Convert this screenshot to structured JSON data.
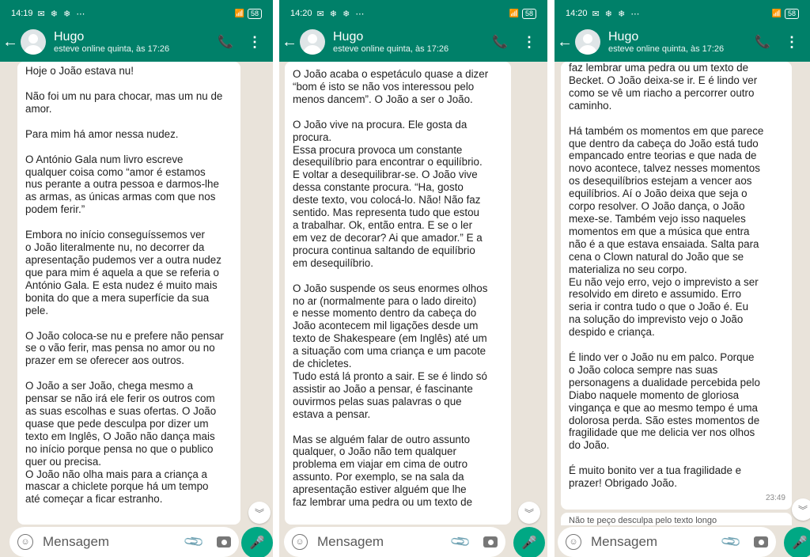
{
  "panels": [
    {
      "status": {
        "time": "14:19",
        "battery": "58"
      },
      "contact": {
        "name": "Hugo",
        "status": "esteve online quinta, às 17:26"
      },
      "paragraphs": [
        "Hoje o João estava nu!",
        "Não foi um nu para chocar, mas um nu de\namor.",
        "Para mim há amor nessa nudez.",
        "O António Gala num livro escreve\nqualquer coisa como “amor é estamos\nnus perante a outra pessoa e darmos-lhe\nas armas, as únicas armas com que nos\npodem ferir.”",
        "Embora no início conseguíssemos ver\no João literalmente nu, no decorrer da\napresentação pudemos ver a outra nudez\nque para mim é aquela a que se referia o\nAntónio Gala. E esta nudez é muito mais\nbonita do que a mera superfície da sua\npele.",
        "O João coloca-se nu e prefere não pensar\nse o vão ferir, mas pensa no amor ou no\nprazer em se oferecer aos outros.",
        "O João a ser João, chega mesmo a\npensar se não irá ele ferir os outros com\nas suas escolhas e suas ofertas. O João\nquase que pede desculpa por dizer um\ntexto em Inglês, O João não dança mais\nno início porque pensa no que o publico\nquer ou precisa.\nO João não olha mais para a criança a\nmascar a chiclete porque há um tempo\naté começar a ficar estranho."
      ],
      "placeholder": "Mensagem"
    },
    {
      "status": {
        "time": "14:20",
        "battery": "58"
      },
      "contact": {
        "name": "Hugo",
        "status": "esteve online quinta, às 17:26"
      },
      "paragraphs": [
        "O João acaba o espetáculo quase a dizer\n“bom é isto se não vos interessou pelo\nmenos dancem”. O João a ser o João.",
        "O João vive na procura. Ele gosta da\nprocura.\nEssa procura provoca um constante\ndesequilíbrio para encontrar o equilíbrio.\nE voltar a desequilibrar-se. O João vive\ndessa constante procura. “Ha, gosto\ndeste texto, vou colocá-lo. Não! Não faz\nsentido. Mas representa tudo que estou\na trabalhar. Ok, então entra. E se o ler\nem vez de decorar? Ai que amador.” E a\nprocura continua saltando de equilíbrio\nem desequilíbrio.",
        "O João suspende os seus enormes olhos\nno ar (normalmente para o lado direito)\ne nesse momento dentro da cabeça do\nJoão acontecem mil ligações desde um\ntexto de Shakespeare (em Inglês) até um\na situação com uma criança e um pacote\nde chicletes.\nTudo está lá pronto a sair. E se é lindo só\nassistir ao João a pensar, é fascinante\nouvirmos pelas suas palavras o que\nestava a pensar.",
        "Mas se alguém falar de outro assunto\nqualquer, o João não tem qualquer\nproblema em viajar em cima de outro\nassunto. Por exemplo, se na sala da\napresentação estiver alguém que lhe\nfaz lembrar uma pedra ou um texto de"
      ],
      "placeholder": "Mensagem"
    },
    {
      "status": {
        "time": "14:20",
        "battery": "58"
      },
      "contact": {
        "name": "Hugo",
        "status": "esteve online quinta, às 17:26"
      },
      "paragraphs": [
        "faz lembrar uma pedra ou um texto de\nBecket. O João deixa-se ir. E é lindo ver\ncomo se vê um riacho a percorrer outro\ncaminho.",
        "Há também os momentos em que parece\nque dentro da cabeça do João está tudo\nempancado entre teorias e que nada de\nnovo acontece, talvez nesses momentos\nos desequilíbrios estejam a vencer aos\nequilíbrios. Aí o João deixa que seja o\ncorpo resolver. O João dança, o João\nmexe-se. Também vejo isso naqueles\nmomentos em que a música que entra\nnão é a que estava ensaiada. Salta para\ncena o Clown natural do João que se\nmaterializa no seu corpo.\nEu não vejo erro, vejo o imprevisto a ser\nresolvido em direto e assumido. Erro\nseria ir contra tudo o que o João é. Eu\nna solução do imprevisto vejo o João\ndespido e criança.",
        "É lindo ver o João nu em palco. Porque\no João coloca sempre nas suas\npersonagens a dualidade percebida pelo\nDiabo naquele momento de gloriosa\nvingança e que ao mesmo tempo é uma\ndolorosa perda. São estes momentos de\nfragilidade que me delicia ver nos olhos\ndo João.",
        "É muito bonito ver a tua fragilidade e\nprazer! Obrigado João."
      ],
      "msg_time": "23:49",
      "next_preview": "Não te peço desculpa pelo texto longo",
      "placeholder": "Mensagem"
    }
  ],
  "icons": {
    "status_icons": "✉ ❄ ❄ ⋯",
    "signal": "📶",
    "back": "←",
    "call": "📞",
    "menu": "⋮",
    "scroll": "︾",
    "emoji": "☺",
    "attach": "📎",
    "mic": "🎤"
  },
  "colors": {
    "header": "#008069",
    "chat_bg": "#e9e3da",
    "mic": "#00a884",
    "bubble": "#ffffff"
  }
}
